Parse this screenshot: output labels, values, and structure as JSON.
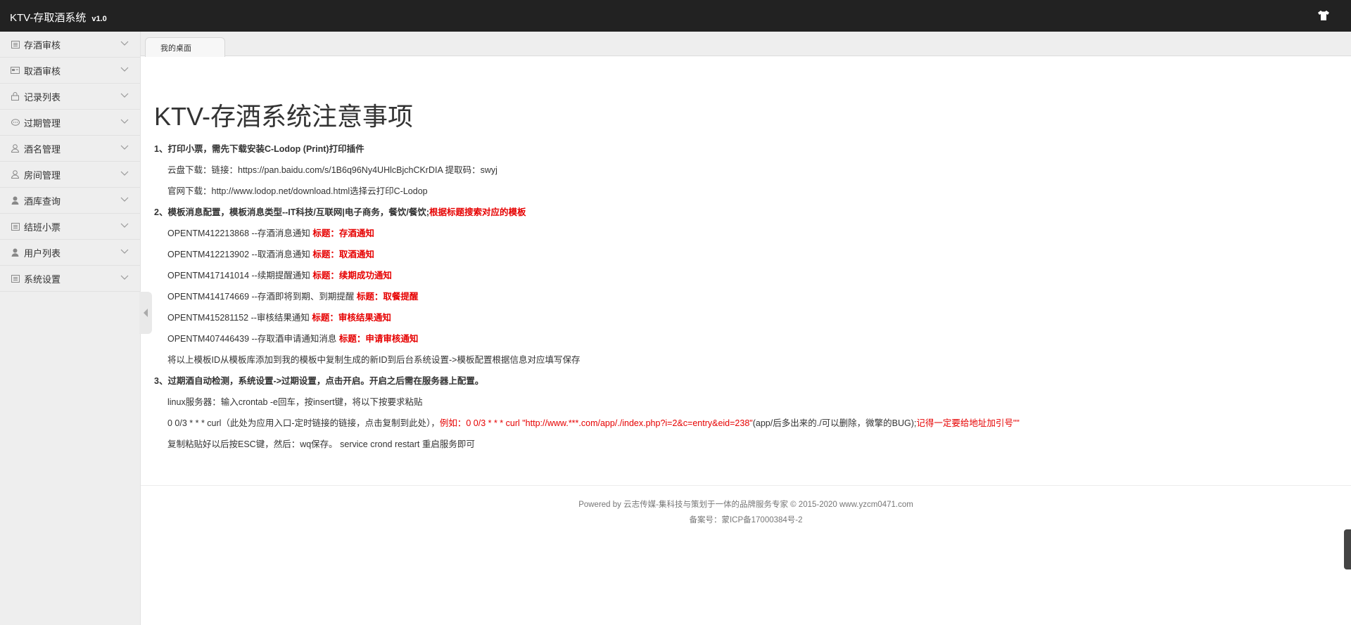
{
  "app": {
    "title": "KTV-存取酒系统",
    "version": "v1.0"
  },
  "sidebar": {
    "items": [
      {
        "label": "存酒审核",
        "icon": "list-icon"
      },
      {
        "label": "取酒审核",
        "icon": "card-icon"
      },
      {
        "label": "记录列表",
        "icon": "lock-icon"
      },
      {
        "label": "过期管理",
        "icon": "chat-icon"
      },
      {
        "label": "酒名管理",
        "icon": "user-outline-icon"
      },
      {
        "label": "房间管理",
        "icon": "user-outline-icon"
      },
      {
        "label": "酒库查询",
        "icon": "user-icon"
      },
      {
        "label": "结班小票",
        "icon": "list-icon"
      },
      {
        "label": "用户列表",
        "icon": "user-icon"
      },
      {
        "label": "系统设置",
        "icon": "list-icon"
      }
    ]
  },
  "tabs": [
    {
      "label": "我的桌面"
    }
  ],
  "main": {
    "title": "KTV-存酒系统注意事项",
    "s1": {
      "heading": "1、打印小票，需先下载安装C-Lodop (Print)打印插件"
    },
    "s1_l1": "云盘下载：链接：https://pan.baidu.com/s/1B6q96Ny4UHlcBjchCKrDIA 提取码：swyj",
    "s1_l2": "官网下载：http://www.lodop.net/download.html选择云打印C-Lodop",
    "s2": {
      "heading": "2、模板消息配置，模板消息类型--IT科技/互联网|电子商务，餐饮/餐饮;",
      "heading_red": "根据标题搜索对应的模板"
    },
    "templates": [
      {
        "text": "OPENTM412213868 --存酒消息通知 ",
        "title": "标题：存酒通知"
      },
      {
        "text": "OPENTM412213902 --取酒消息通知 ",
        "title": "标题：取酒通知"
      },
      {
        "text": "OPENTM417141014 --续期提醒通知 ",
        "title": "标题：续期成功通知"
      },
      {
        "text": "OPENTM414174669 --存酒即将到期、到期提醒 ",
        "title": "标题：取餐提醒"
      },
      {
        "text": "OPENTM415281152 --审核结果通知 ",
        "title": "标题：审核结果通知"
      },
      {
        "text": "OPENTM407446439 --存取酒申请通知消息 ",
        "title": "标题：申请审核通知"
      }
    ],
    "s2_note": "将以上模板ID从模板库添加到我的模板中复制生成的新ID到后台系统设置->模板配置根据信息对应填写保存",
    "s3": {
      "heading": "3、过期酒自动检测，系统设置->过期设置，点击开启。开启之后需在服务器上配置。"
    },
    "s3_l1": "linux服务器：输入crontab -e回车，按insert键，将以下按要求粘贴",
    "s3_l2": {
      "a": "0 0/3 * * * curl（此处为应用入口-定时链接的链接，点击复制到此处），",
      "b": "例如：0 0/3 * * * curl \"http://www.***.com/app/./index.php?i=2&c=entry&eid=238\"",
      "c": "(app/后多出来的./可以删除，微擎的BUG);",
      "d": "记得一定要给地址加引号\"\""
    },
    "s3_l3": "复制粘贴好以后按ESC键，然后：wq保存。 service crond restart 重启服务即可"
  },
  "footer": {
    "line1": "Powered by 云志传媒-集科技与策划于一体的品牌服务专家 © 2015-2020 www.yzcm0471.com",
    "line2": "备案号：蒙ICP备17000384号-2"
  }
}
